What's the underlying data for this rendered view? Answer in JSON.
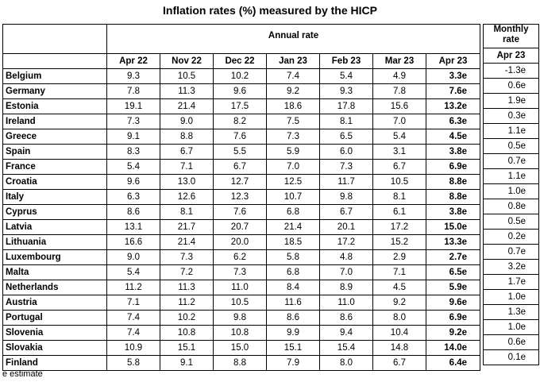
{
  "title": "Inflation rates (%) measured by the HICP",
  "annual_header": "Annual rate",
  "monthly_header_line1": "Monthly",
  "monthly_header_line2": "rate",
  "columns": [
    "Apr 22",
    "Nov 22",
    "Dec 22",
    "Jan 23",
    "Feb 23",
    "Mar 23",
    "Apr 23"
  ],
  "monthly_column": "Apr 23",
  "rows": [
    {
      "country": "Belgium",
      "values": [
        "9.3",
        "10.5",
        "10.2",
        "7.4",
        "5.4",
        "4.9",
        "3.3e"
      ],
      "monthly": "-1.3e"
    },
    {
      "country": "Germany",
      "values": [
        "7.8",
        "11.3",
        "9.6",
        "9.2",
        "9.3",
        "7.8",
        "7.6e"
      ],
      "monthly": "0.6e"
    },
    {
      "country": "Estonia",
      "values": [
        "19.1",
        "21.4",
        "17.5",
        "18.6",
        "17.8",
        "15.6",
        "13.2e"
      ],
      "monthly": "1.9e"
    },
    {
      "country": "Ireland",
      "values": [
        "7.3",
        "9.0",
        "8.2",
        "7.5",
        "8.1",
        "7.0",
        "6.3e"
      ],
      "monthly": "0.3e"
    },
    {
      "country": "Greece",
      "values": [
        "9.1",
        "8.8",
        "7.6",
        "7.3",
        "6.5",
        "5.4",
        "4.5e"
      ],
      "monthly": "1.1e"
    },
    {
      "country": "Spain",
      "values": [
        "8.3",
        "6.7",
        "5.5",
        "5.9",
        "6.0",
        "3.1",
        "3.8e"
      ],
      "monthly": "0.5e"
    },
    {
      "country": "France",
      "values": [
        "5.4",
        "7.1",
        "6.7",
        "7.0",
        "7.3",
        "6.7",
        "6.9e"
      ],
      "monthly": "0.7e"
    },
    {
      "country": "Croatia",
      "values": [
        "9.6",
        "13.0",
        "12.7",
        "12.5",
        "11.7",
        "10.5",
        "8.8e"
      ],
      "monthly": "1.1e"
    },
    {
      "country": "Italy",
      "values": [
        "6.3",
        "12.6",
        "12.3",
        "10.7",
        "9.8",
        "8.1",
        "8.8e"
      ],
      "monthly": "1.0e"
    },
    {
      "country": "Cyprus",
      "values": [
        "8.6",
        "8.1",
        "7.6",
        "6.8",
        "6.7",
        "6.1",
        "3.8e"
      ],
      "monthly": "0.8e"
    },
    {
      "country": "Latvia",
      "values": [
        "13.1",
        "21.7",
        "20.7",
        "21.4",
        "20.1",
        "17.2",
        "15.0e"
      ],
      "monthly": "0.5e"
    },
    {
      "country": "Lithuania",
      "values": [
        "16.6",
        "21.4",
        "20.0",
        "18.5",
        "17.2",
        "15.2",
        "13.3e"
      ],
      "monthly": "0.2e"
    },
    {
      "country": "Luxembourg",
      "values": [
        "9.0",
        "7.3",
        "6.2",
        "5.8",
        "4.8",
        "2.9",
        "2.7e"
      ],
      "monthly": "0.7e"
    },
    {
      "country": "Malta",
      "values": [
        "5.4",
        "7.2",
        "7.3",
        "6.8",
        "7.0",
        "7.1",
        "6.5e"
      ],
      "monthly": "3.2e"
    },
    {
      "country": "Netherlands",
      "values": [
        "11.2",
        "11.3",
        "11.0",
        "8.4",
        "8.9",
        "4.5",
        "5.9e"
      ],
      "monthly": "1.7e"
    },
    {
      "country": "Austria",
      "values": [
        "7.1",
        "11.2",
        "10.5",
        "11.6",
        "11.0",
        "9.2",
        "9.6e"
      ],
      "monthly": "1.0e"
    },
    {
      "country": "Portugal",
      "values": [
        "7.4",
        "10.2",
        "9.8",
        "8.6",
        "8.6",
        "8.0",
        "6.9e"
      ],
      "monthly": "1.3e"
    },
    {
      "country": "Slovenia",
      "values": [
        "7.4",
        "10.8",
        "10.8",
        "9.9",
        "9.4",
        "10.4",
        "9.2e"
      ],
      "monthly": "1.0e"
    },
    {
      "country": "Slovakia",
      "values": [
        "10.9",
        "15.1",
        "15.0",
        "15.1",
        "15.4",
        "14.8",
        "14.0e"
      ],
      "monthly": "0.6e"
    },
    {
      "country": "Finland",
      "values": [
        "5.8",
        "9.1",
        "8.8",
        "7.9",
        "8.0",
        "6.7",
        "6.4e"
      ],
      "monthly": "0.1e"
    }
  ],
  "footnote": "e estimate"
}
